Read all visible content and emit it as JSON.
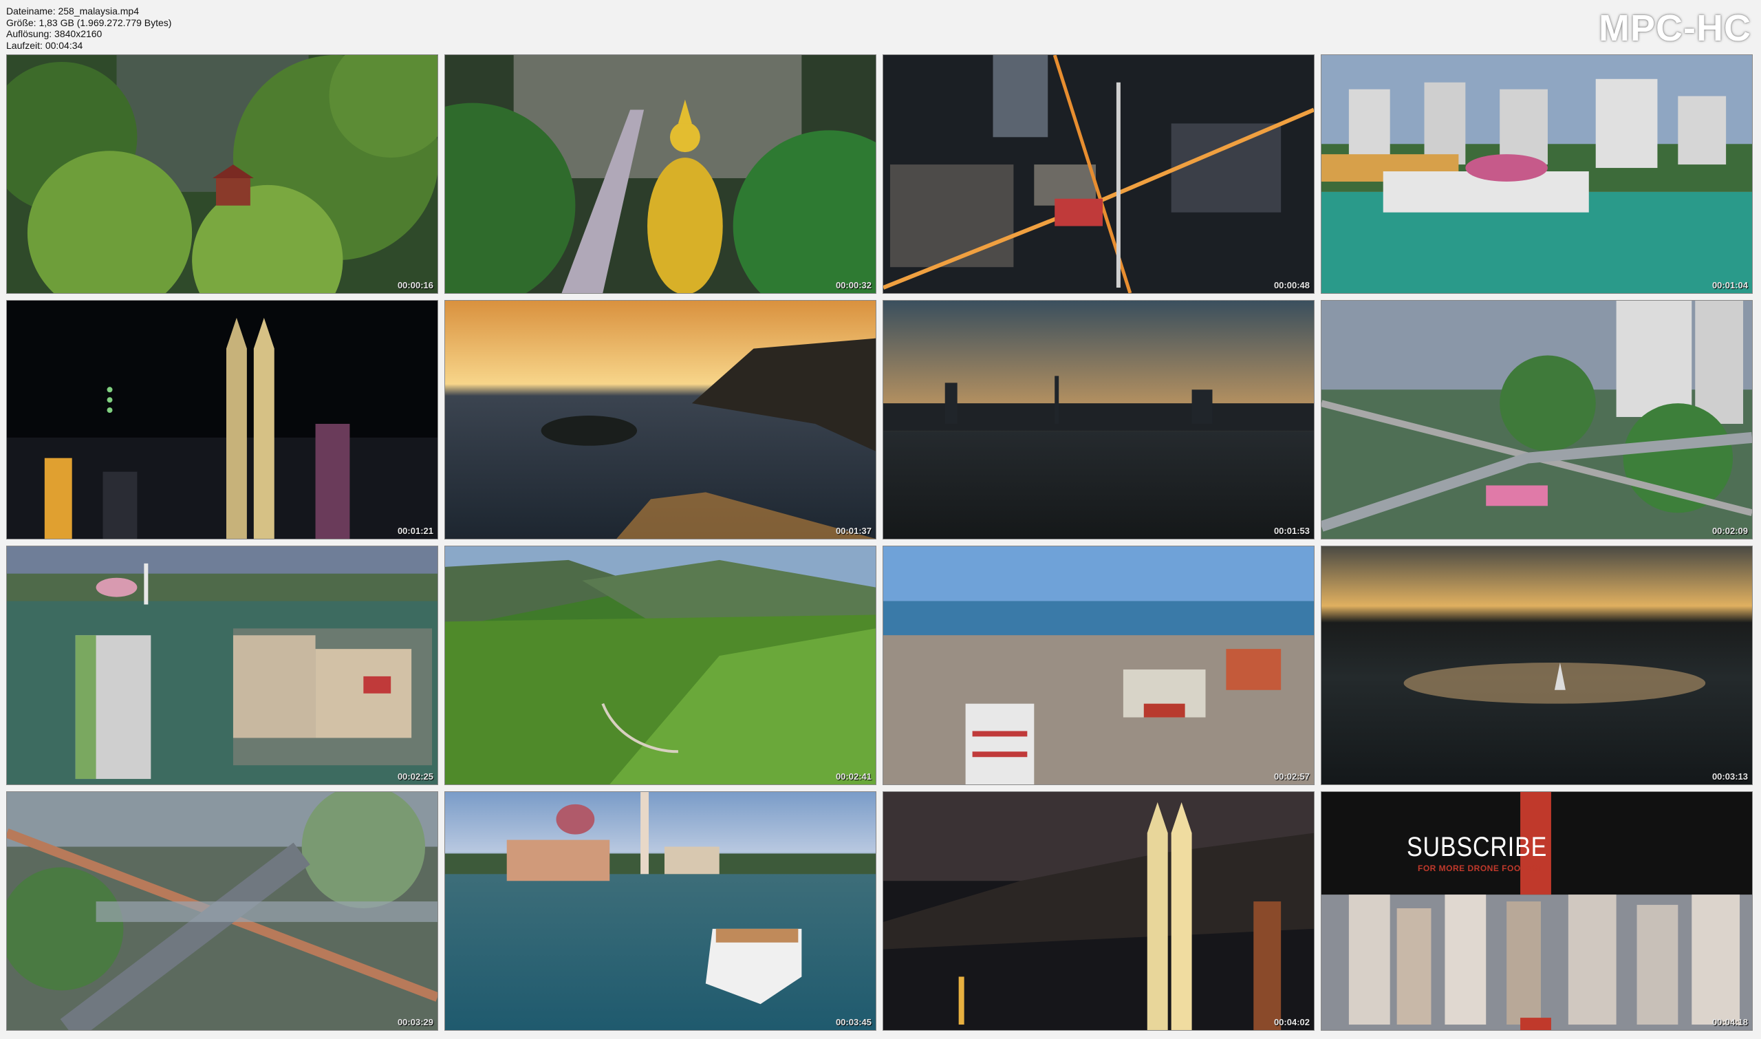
{
  "file_info": {
    "name": "Dateiname: 258_malaysia.mp4",
    "size": "Größe: 1,83 GB (1.969.272.779 Bytes)",
    "resolution": "Auflösung: 3840x2160",
    "duration": "Laufzeit: 00:04:34"
  },
  "logo": "MPC-HC",
  "thumbnails": [
    {
      "time": "00:00:16",
      "scene": "jungle temple"
    },
    {
      "time": "00:00:32",
      "scene": "golden statue stairs"
    },
    {
      "time": "00:00:48",
      "scene": "city night aerial"
    },
    {
      "time": "00:01:04",
      "scene": "floating mosque"
    },
    {
      "time": "00:01:21",
      "scene": "petronas towers night"
    },
    {
      "time": "00:01:37",
      "scene": "sunset sea"
    },
    {
      "time": "00:01:53",
      "scene": "city skyline dusk"
    },
    {
      "time": "00:02:09",
      "scene": "railway city aerial"
    },
    {
      "time": "00:02:25",
      "scene": "putrajaya lake"
    },
    {
      "time": "00:02:41",
      "scene": "tea plantation hills"
    },
    {
      "time": "00:02:57",
      "scene": "georgetown aerial"
    },
    {
      "time": "00:03:13",
      "scene": "lake fountain sunset"
    },
    {
      "time": "00:03:29",
      "scene": "highway overlay"
    },
    {
      "time": "00:03:45",
      "scene": "pink mosque boat"
    },
    {
      "time": "00:04:02",
      "scene": "petronas dusk"
    },
    {
      "time": "00:04:18",
      "scene": "subscribe"
    }
  ],
  "subscribe": {
    "title": "SUBSCRIBE",
    "subtitle": "FOR MORE DRONE FOOTAGE"
  },
  "colors": {
    "background": "#f2f2f2",
    "accent_red": "#c0392b"
  }
}
